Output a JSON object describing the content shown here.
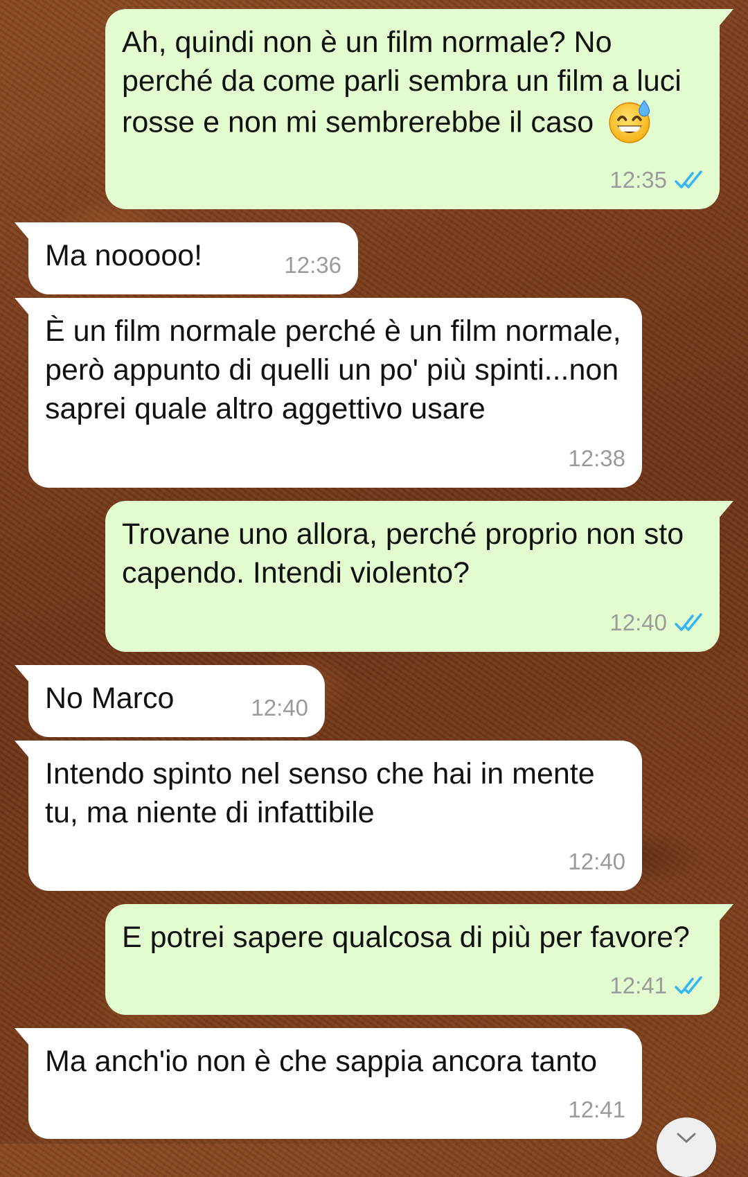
{
  "conversation": {
    "messages": [
      {
        "direction": "outgoing",
        "text": "Ah, quindi non è un film normale? No perché da come parli sembra un film a luci rosse e non mi sembrerebbe il caso",
        "emoji": "grinning-face-with-sweat",
        "time": "12:35",
        "status": "read"
      },
      {
        "direction": "incoming",
        "text": "Ma nooooo!",
        "time": "12:36"
      },
      {
        "direction": "incoming",
        "text": "È un film normale perché è un film normale, però appunto di quelli un po' più spinti...non saprei quale altro aggettivo usare",
        "time": "12:38"
      },
      {
        "direction": "outgoing",
        "text": "Trovane uno allora, perché proprio non sto capendo. Intendi violento?",
        "time": "12:40",
        "status": "read"
      },
      {
        "direction": "incoming",
        "text": "No Marco",
        "time": "12:40"
      },
      {
        "direction": "incoming",
        "text": "Intendo spinto nel senso che hai in mente tu, ma niente di infattibile",
        "time": "12:40"
      },
      {
        "direction": "outgoing",
        "text": "E potrei sapere qualcosa di più per favore?",
        "time": "12:41",
        "status": "read"
      },
      {
        "direction": "incoming",
        "text": "Ma anch'io non è che sappia ancora tanto",
        "time": "12:41"
      }
    ]
  },
  "icons": {
    "read_ticks": "double-check-icon",
    "scroll_down": "chevron-down-icon",
    "emoji": "grinning-face-with-sweat-emoji"
  },
  "colors": {
    "outgoing_bubble": "#e2fccf",
    "incoming_bubble": "#ffffff",
    "read_tick": "#34b7f1",
    "timestamp": "#9a9a9a",
    "wallpaper": "#7a3f1e"
  }
}
